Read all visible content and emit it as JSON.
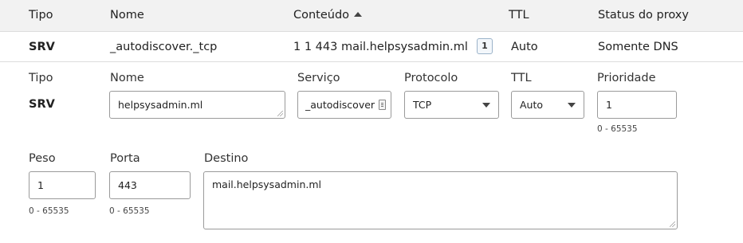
{
  "table": {
    "headers": {
      "tipo": "Tipo",
      "nome": "Nome",
      "conteudo": "Conteúdo",
      "ttl": "TTL",
      "status": "Status do proxy"
    },
    "record": {
      "tipo": "SRV",
      "nome": "_autodiscover._tcp",
      "conteudo": "1 1 443 mail.helpsysadmin.ml",
      "count": "1",
      "ttl": "Auto",
      "status": "Somente DNS"
    }
  },
  "form": {
    "labels": {
      "tipo": "Tipo",
      "nome": "Nome",
      "servico": "Serviço",
      "protocolo": "Protocolo",
      "ttl": "TTL",
      "prioridade": "Prioridade",
      "peso": "Peso",
      "porta": "Porta",
      "destino": "Destino"
    },
    "tipo_value": "SRV",
    "nome_value": "helpsysadmin.ml",
    "servico_value": "_autodiscover",
    "protocolo_value": "TCP",
    "ttl_value": "Auto",
    "prioridade_value": "1",
    "prioridade_hint": "0 - 65535",
    "peso_value": "1",
    "peso_hint": "0 - 65535",
    "porta_value": "443",
    "porta_hint": "0 - 65535",
    "destino_value": "mail.helpsysadmin.ml"
  }
}
